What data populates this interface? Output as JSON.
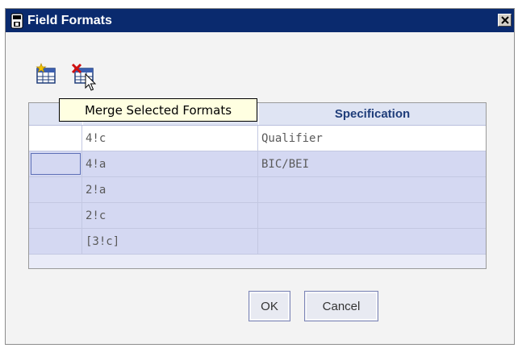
{
  "window": {
    "title": "Field Formats",
    "title_icon": "floppy-disk-icon",
    "close_icon": "close-icon"
  },
  "toolbar": {
    "merge_icon": "merge-formats-icon",
    "delete_icon": "delete-formats-icon",
    "tooltip": "Merge Selected Formats"
  },
  "grid": {
    "columns": [
      "",
      "",
      "Specification"
    ],
    "rows": [
      {
        "format": "4!c",
        "specification": "Qualifier"
      },
      {
        "format": "4!a",
        "specification": "BIC/BEI"
      },
      {
        "format": "2!a",
        "specification": ""
      },
      {
        "format": "2!c",
        "specification": ""
      },
      {
        "format": "[3!c]",
        "specification": ""
      }
    ]
  },
  "buttons": {
    "ok": "OK",
    "cancel": "Cancel"
  },
  "colors": {
    "titlebar": "#0a2a6e",
    "header_text": "#1f3d7a",
    "selected_row": "#d4d8f2",
    "tooltip_bg": "#ffffe1"
  }
}
